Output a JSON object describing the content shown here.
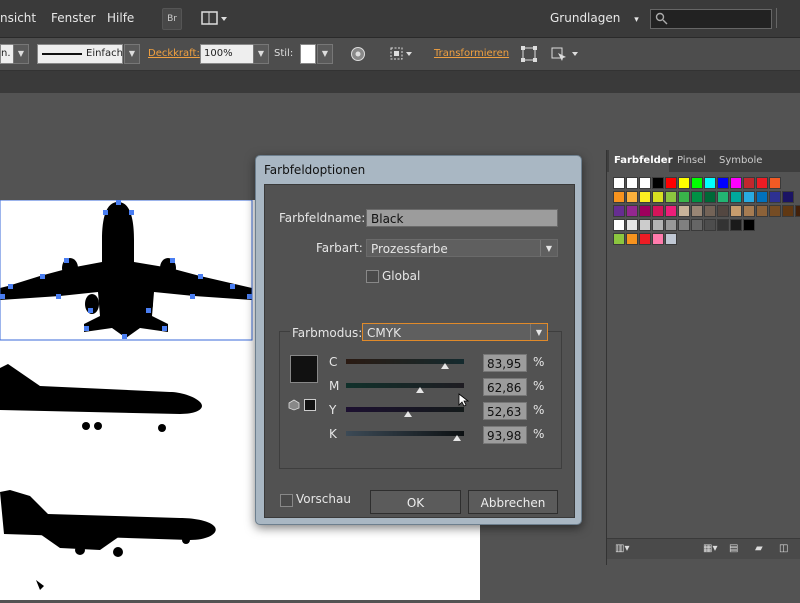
{
  "menubar": {
    "items": [
      "nsicht",
      "Fenster",
      "Hilfe"
    ],
    "br_label": "Br",
    "workspace": "Grundlagen",
    "workspace_arrow": "▾"
  },
  "optionbar": {
    "partial_label": "n.",
    "stroke_style": "Einfach",
    "opacity_label": "Deckkraft:",
    "opacity_value": "100%",
    "style_label": "Stil:",
    "transform_label": "Transformieren"
  },
  "dialog": {
    "title": "Farbfeldoptionen",
    "name_label": "Farbfeldname:",
    "name_value": "Black",
    "type_label": "Farbart:",
    "type_value": "Prozessfarbe",
    "global_label": "Global",
    "mode_label": "Farbmodus:",
    "mode_value": "CMYK",
    "channels": [
      {
        "label": "C",
        "value": "83,95",
        "unit": "%",
        "level": 0.8395
      },
      {
        "label": "M",
        "value": "62,86",
        "unit": "%",
        "level": 0.6286
      },
      {
        "label": "Y",
        "value": "52,63",
        "unit": "%",
        "level": 0.5263
      },
      {
        "label": "K",
        "value": "93,98",
        "unit": "%",
        "level": 0.9398
      }
    ],
    "preview_label": "Vorschau",
    "ok_label": "OK",
    "cancel_label": "Abbrechen"
  },
  "panel": {
    "tabs": [
      "Farbfelder",
      "Pinsel",
      "Symbole"
    ],
    "swatch_rows": [
      [
        "#ffffff",
        "#ffffff",
        "#ffffff",
        "#000000",
        "#ff0000",
        "#ffff00",
        "#00ff00",
        "#00ffff",
        "#0000ff",
        "#ff00ff",
        "#c1272d",
        "#ed1c24",
        "#f15a24"
      ],
      [
        "#f7931e",
        "#fbb03b",
        "#fcee21",
        "#d9e021",
        "#8cc63f",
        "#39b54a",
        "#009245",
        "#006837",
        "#22b573",
        "#00a99d",
        "#29abe2",
        "#0071bc",
        "#2e3192",
        "#1b1464"
      ],
      [
        "#662d91",
        "#93278f",
        "#9e005d",
        "#d4145a",
        "#ed1e79",
        "#c7b299",
        "#998675",
        "#736357",
        "#534741",
        "#c69c6d",
        "#a67c52",
        "#8c6239",
        "#754c24",
        "#603813",
        "#42210b"
      ],
      [
        "#ffffff",
        "#e6e6e6",
        "#cccccc",
        "#b3b3b3",
        "#999999",
        "#808080",
        "#666666",
        "#4d4d4d",
        "#333333",
        "#1a1a1a",
        "#000000"
      ],
      [
        "#8cc63f",
        "#f7931e",
        "#ed1c24",
        "#ff7bac",
        "#c0c8d4"
      ]
    ]
  }
}
